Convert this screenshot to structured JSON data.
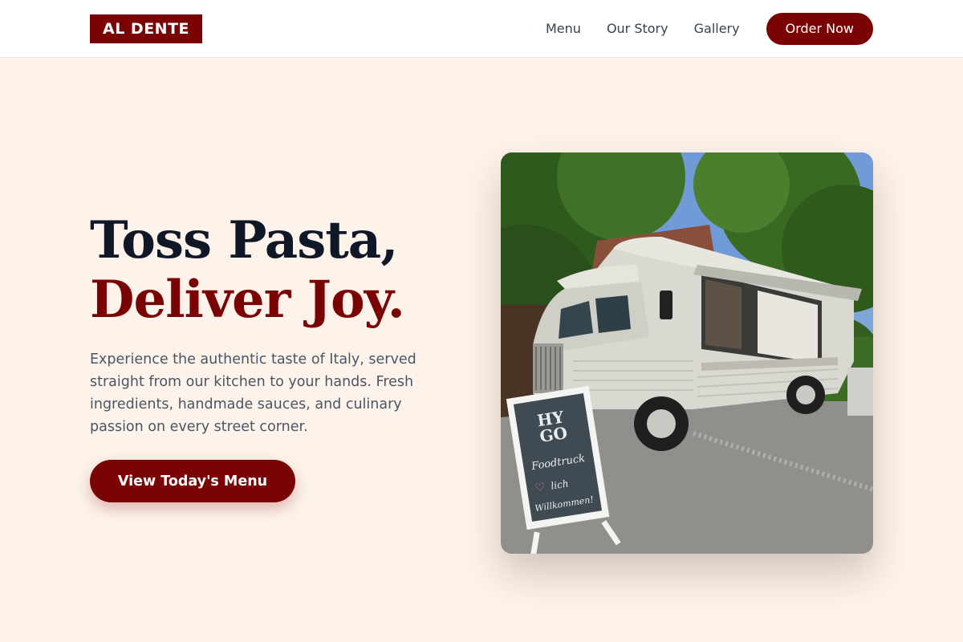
{
  "brand": {
    "logo_text": "AL DENTE",
    "accent_color": "#7a0404"
  },
  "nav": {
    "links": [
      {
        "label": "Menu"
      },
      {
        "label": "Our Story"
      },
      {
        "label": "Gallery"
      }
    ],
    "cta_label": "Order Now"
  },
  "hero": {
    "title_line1": "Toss Pasta,",
    "title_line2": "Deliver Joy.",
    "description": "Experience the authentic taste of Italy, served straight from our kitchen to your hands. Fresh ingredients, handmade sauces, and culinary passion on every street corner.",
    "cta_label": "View Today's Menu",
    "image": {
      "sign_line1": "HY",
      "sign_line2": "GO",
      "sign_line3": "Foodtruck",
      "sign_line4": "lich",
      "sign_line5": "Willkommen!"
    }
  }
}
